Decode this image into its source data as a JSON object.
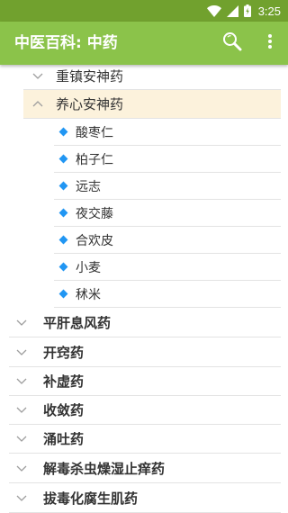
{
  "status": {
    "time": "3:25"
  },
  "app_bar": {
    "title": "中医百科: 中药"
  },
  "tree": [
    {
      "label": "重镇安神药",
      "level": 1,
      "expanded": false
    },
    {
      "label": "养心安神药",
      "level": 1,
      "expanded": true,
      "selected": true
    },
    {
      "label": "酸枣仁",
      "level": 2
    },
    {
      "label": "柏子仁",
      "level": 2
    },
    {
      "label": "远志",
      "level": 2
    },
    {
      "label": "夜交藤",
      "level": 2
    },
    {
      "label": "合欢皮",
      "level": 2
    },
    {
      "label": "小麦",
      "level": 2
    },
    {
      "label": "秫米",
      "level": 2
    },
    {
      "label": "平肝息风药",
      "level": 0,
      "expanded": false
    },
    {
      "label": "开窍药",
      "level": 0,
      "expanded": false
    },
    {
      "label": "补虚药",
      "level": 0,
      "expanded": false
    },
    {
      "label": "收敛药",
      "level": 0,
      "expanded": false
    },
    {
      "label": "涌吐药",
      "level": 0,
      "expanded": false
    },
    {
      "label": "解毒杀虫燥湿止痒药",
      "level": 0,
      "expanded": false
    },
    {
      "label": "拔毒化腐生肌药",
      "level": 0,
      "expanded": false
    }
  ],
  "colors": {
    "status_bar": "#71a12e",
    "app_bar": "#8bc34a",
    "selected_row": "#fcf2dc",
    "bullet": "#2196f3"
  },
  "icons": {
    "search": "search-icon",
    "more": "more-vert-icon",
    "wifi": "wifi-icon",
    "signal": "signal-icon",
    "battery": "battery-icon",
    "expand": "chevron-down-icon",
    "collapse": "chevron-up-icon",
    "bullet": "diamond-bullet-icon"
  }
}
